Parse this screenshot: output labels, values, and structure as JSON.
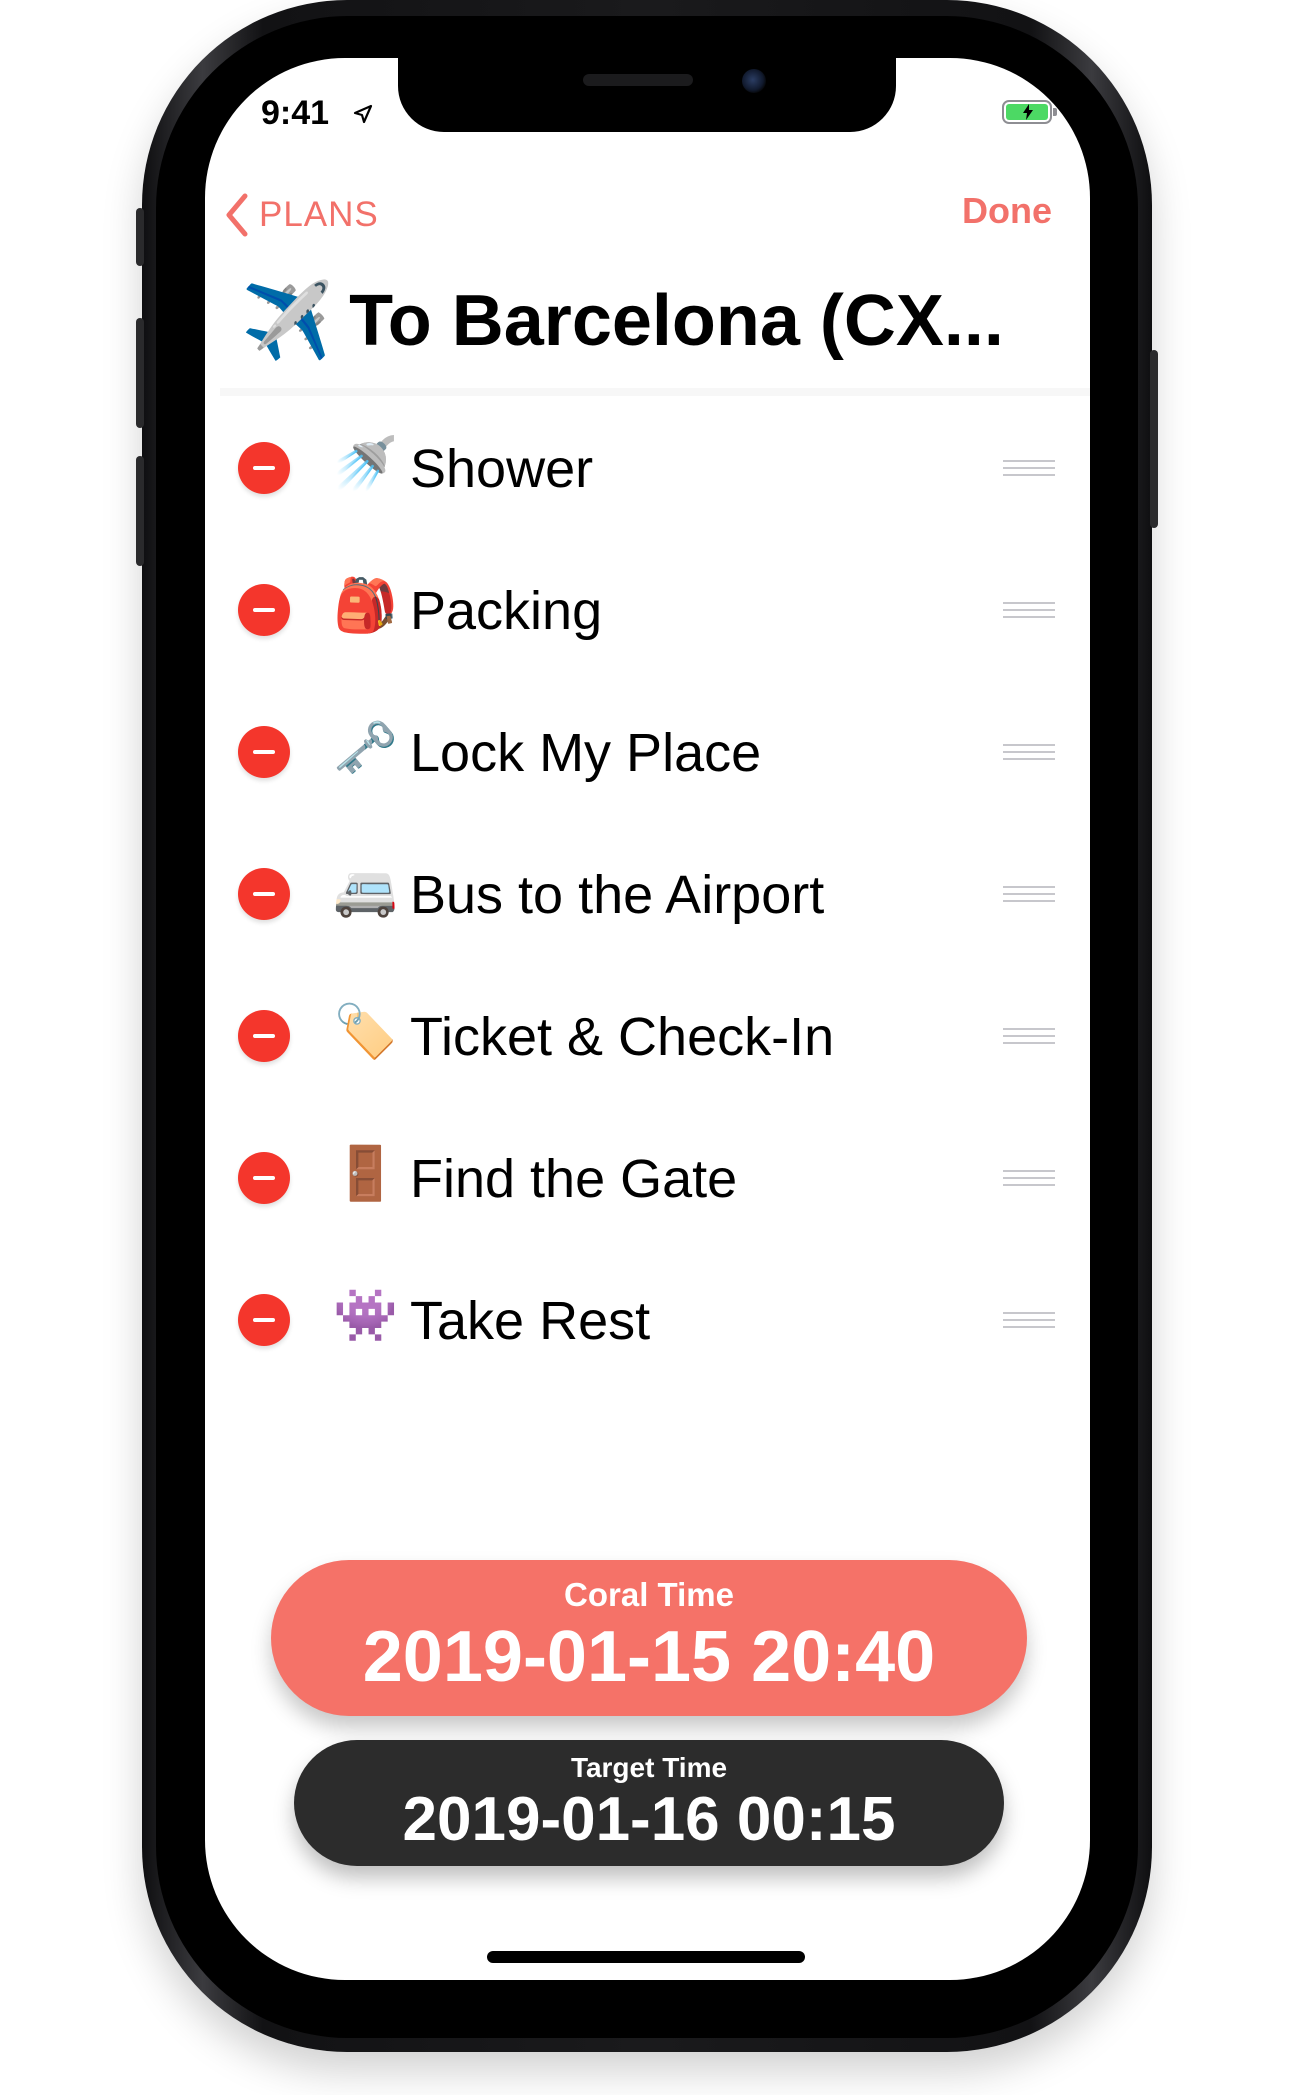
{
  "status_bar": {
    "time": "9:41",
    "icons": [
      "location-arrow-icon",
      "battery-charging-icon"
    ]
  },
  "nav": {
    "back_label": "PLANS",
    "done_label": "Done",
    "accent_color": "#f2716a"
  },
  "plan": {
    "title_emoji": "✈️",
    "title": "To Barcelona (CX..."
  },
  "items": [
    {
      "emoji": "🚿",
      "label": "Shower"
    },
    {
      "emoji": "🎒",
      "label": "Packing"
    },
    {
      "emoji": "🗝️",
      "label": "Lock My Place"
    },
    {
      "emoji": "🚐",
      "label": "Bus to the Airport"
    },
    {
      "emoji": "🏷️",
      "label": "Ticket & Check-In"
    },
    {
      "emoji": "🚪",
      "label": "Find the Gate"
    },
    {
      "emoji": "👾",
      "label": "Take Rest"
    }
  ],
  "coral_time": {
    "label": "Coral Time",
    "value": "2019-01-15 20:40",
    "color": "#f57268"
  },
  "target_time": {
    "label": "Target Time",
    "value": "2019-01-16 00:15",
    "color": "#2c2c2c"
  },
  "colors": {
    "delete": "#f4362c",
    "battery": "#4cd964"
  }
}
